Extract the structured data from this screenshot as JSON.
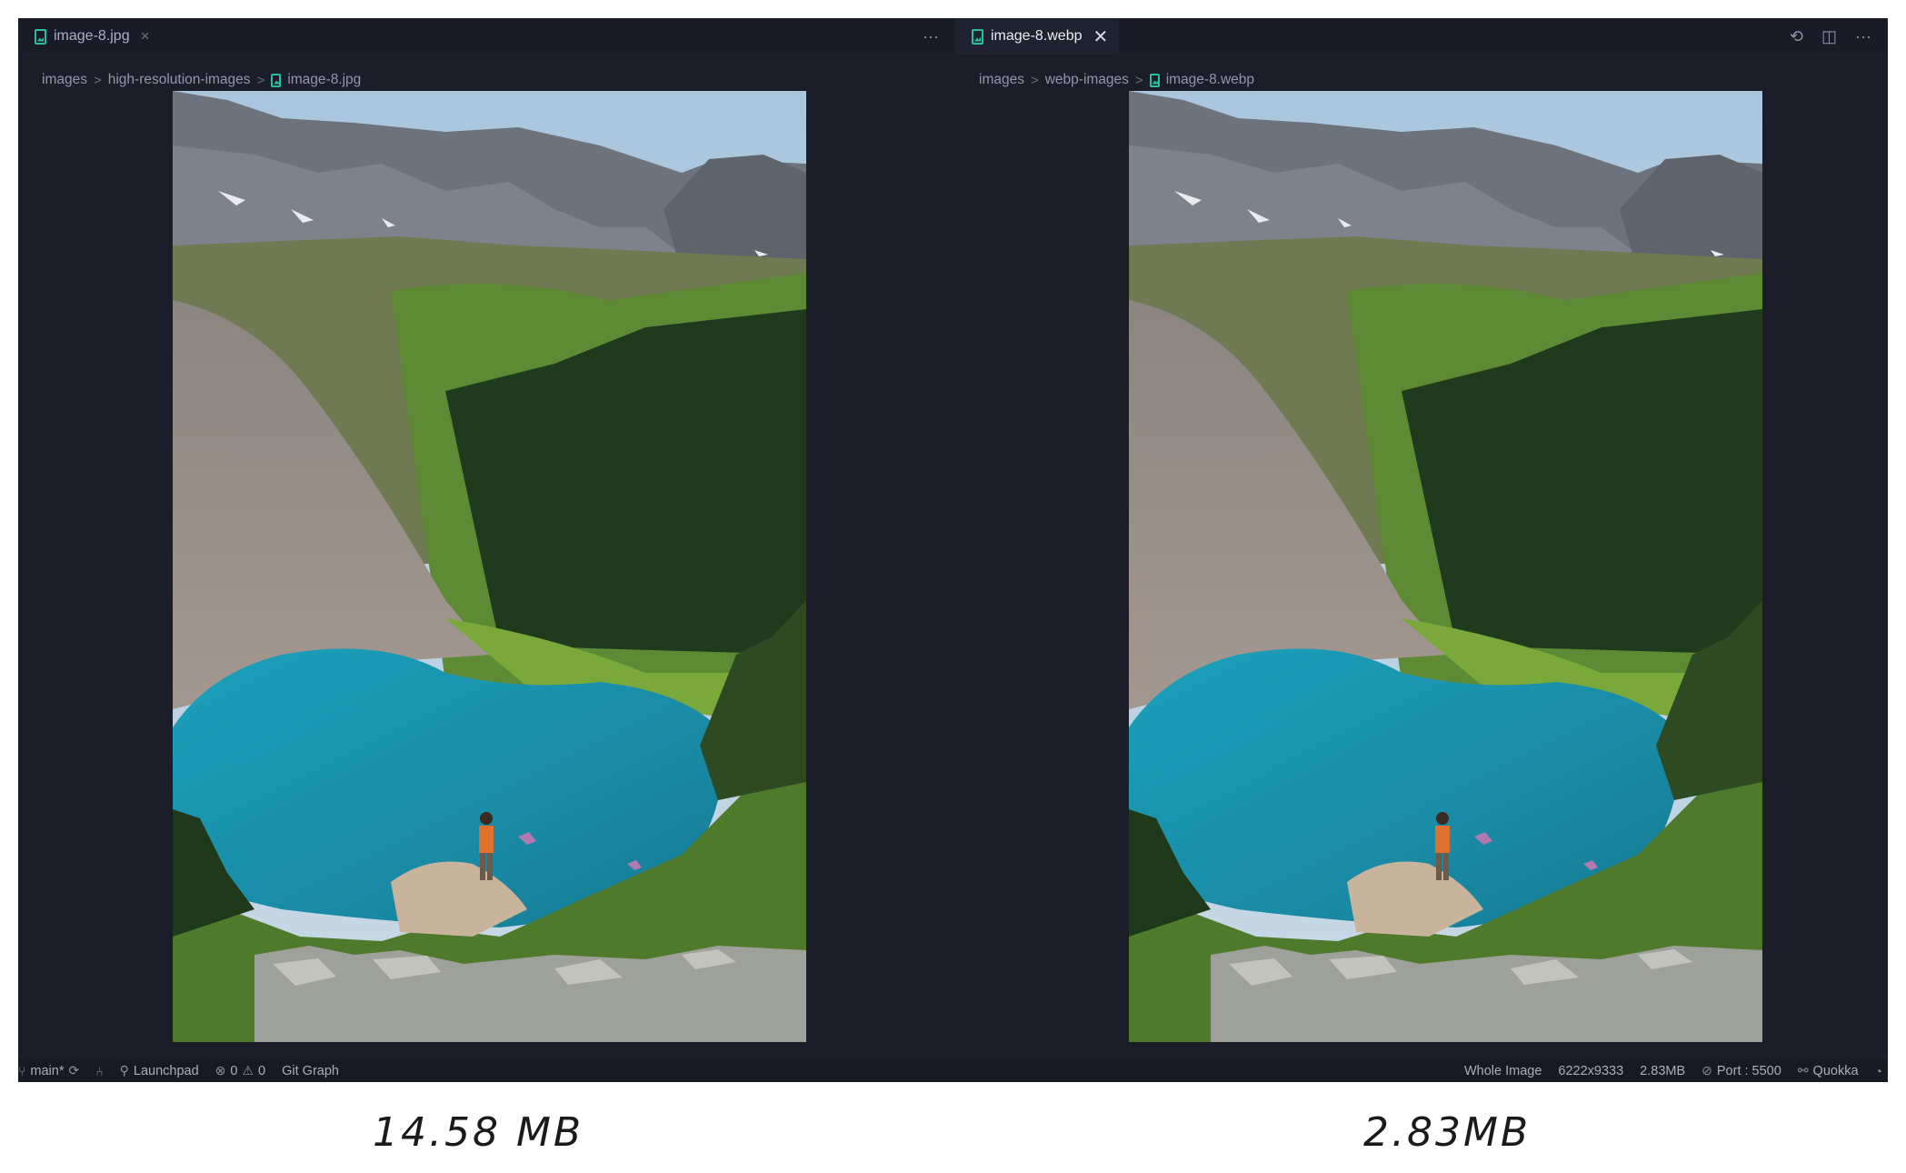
{
  "left_pane": {
    "tab": {
      "label": "image-8.jpg",
      "close": "×"
    },
    "tab_actions": {
      "more": "···"
    },
    "breadcrumb": [
      "images",
      "high-resolution-images",
      "image-8.jpg"
    ],
    "breadcrumb_sep": ">",
    "image_alt": "Hiker overlooking a turquoise alpine lake beneath rocky mountain peaks"
  },
  "right_pane": {
    "tab": {
      "label": "image-8.webp",
      "close": "✕"
    },
    "tab_actions": {
      "history": "⟲",
      "split": "◫",
      "more": "···"
    },
    "breadcrumb": [
      "images",
      "webp-images",
      "image-8.webp"
    ],
    "breadcrumb_sep": ">",
    "image_alt": "Hiker overlooking a turquoise alpine lake beneath rocky mountain peaks"
  },
  "statusbar": {
    "branch": "main*",
    "launchpad": "Launchpad",
    "errors": "0",
    "warnings": "0",
    "git_graph": "Git Graph",
    "zoom_mode": "Whole Image",
    "dimensions": "6222x9333",
    "file_size": "2.83MB",
    "port": "Port : 5500",
    "quokka": "Quokka"
  },
  "captions": {
    "left": "14.58 MB",
    "right": "2.83MB"
  },
  "colors": {
    "editor_bg": "#1b1e29",
    "tab_active_bg": "#1f2330",
    "icon_accent": "#2bbfa0",
    "lake": "#1e93ad"
  }
}
